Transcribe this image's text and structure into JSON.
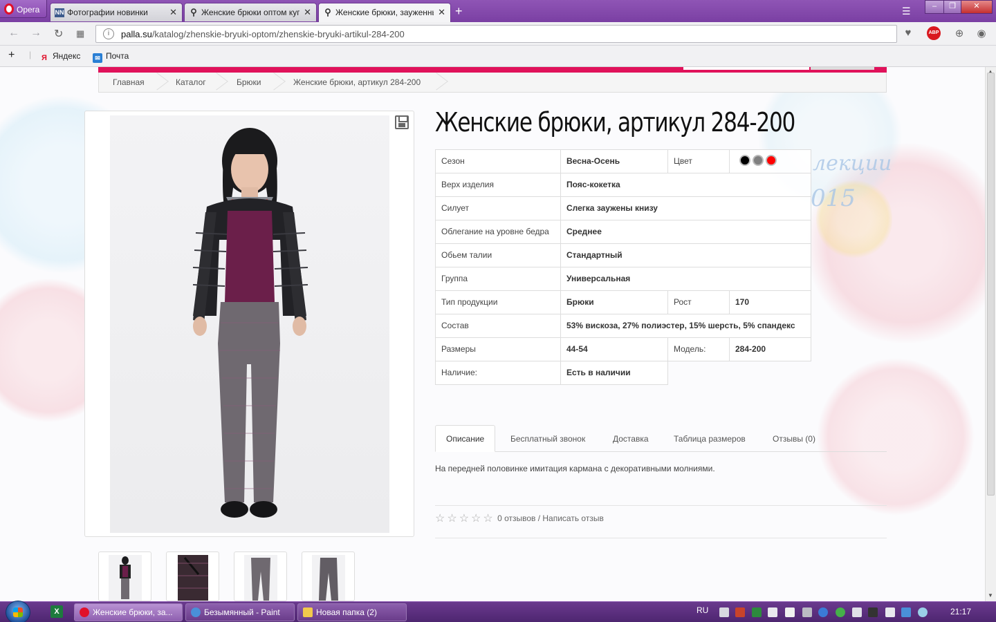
{
  "browser": {
    "menu_label": "Opera",
    "tabs": [
      {
        "title": "Фотографии новинки",
        "icon": "NN"
      },
      {
        "title": "Женские брюки оптом купить",
        "icon": "figure"
      },
      {
        "title": "Женские брюки, зауженные",
        "icon": "figure"
      }
    ],
    "url_domain": "palla.su",
    "url_path": "/katalog/zhenskie-bryuki-optom/zhenskie-bryuki-artikul-284-200",
    "abp_label": "ABP",
    "bookmarks": [
      {
        "label": "Яндекс",
        "icon": "Я"
      },
      {
        "label": "Почта",
        "icon": "mail"
      }
    ]
  },
  "page": {
    "breadcrumbs": [
      "Главная",
      "Каталог",
      "Брюки",
      "Женские брюки, артикул 284-200"
    ],
    "title": "Женские брюки, артикул 284-200",
    "bg_text": [
      "лекции",
      "015"
    ],
    "attributes": {
      "season_label": "Сезон",
      "season_value": "Весна-Осень",
      "color_label": "Цвет",
      "colors": [
        "#000000",
        "#808080",
        "#ff0000"
      ],
      "top_label": "Верх изделия",
      "top_value": "Пояс-кокетка",
      "silhouette_label": "Силует",
      "silhouette_value": "Слегка заужены книзу",
      "fit_label": "Облегание на уровне бедра",
      "fit_value": "Среднее",
      "waist_label": "Обьем талии",
      "waist_value": "Стандартный",
      "group_label": "Группа",
      "group_value": "Универсальная",
      "type_label": "Тип продукции",
      "type_value": "Брюки",
      "height_label": "Рост",
      "height_value": "170",
      "composition_label": "Состав",
      "composition_value": "53% вискоза, 27% полиэстер, 15% шерсть, 5% спандекс",
      "sizes_label": "Размеры",
      "sizes_value": "44-54",
      "model_label": "Модель:",
      "model_value": "284-200",
      "availability_label": "Наличие:",
      "availability_value": "Есть в наличии"
    },
    "tabs": [
      "Описание",
      "Бесплатный звонок",
      "Доставка",
      "Таблица размеров",
      "Отзывы (0)"
    ],
    "description": "На передней половинке имитация кармана с декоративными молниями.",
    "rating": {
      "stars": 0,
      "max": 5,
      "text": "0 отзывов / Написать отзыв"
    }
  },
  "taskbar": {
    "items": [
      {
        "label": "Женские брюки, за...",
        "icon_color": "#e0102a"
      },
      {
        "label": "Безымянный - Paint",
        "icon_color": "#4a90d9"
      },
      {
        "label": "Новая папка (2)",
        "icon_color": "#f2c94c"
      }
    ],
    "lang": "RU",
    "time": "21:17"
  }
}
